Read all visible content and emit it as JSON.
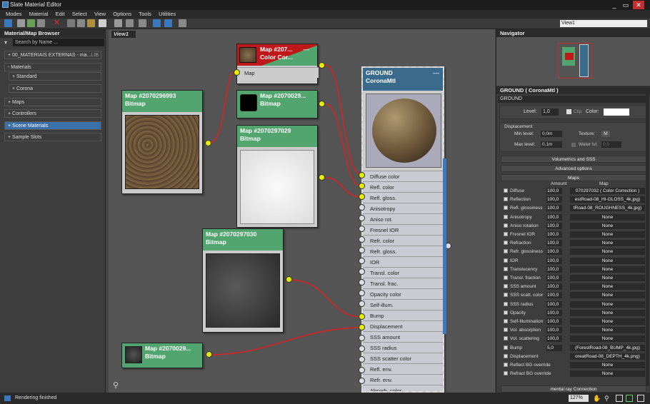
{
  "window": {
    "title": "Slate Material Editor",
    "minimize": "_",
    "restore": "▭",
    "close": "✕"
  },
  "menu": [
    "Modes",
    "Material",
    "Edit",
    "Select",
    "View",
    "Options",
    "Tools",
    "Utilities"
  ],
  "toolbar": {
    "view_select": "View1"
  },
  "browser": {
    "title": "Material/Map Browser",
    "search_placeholder": "Search by Name ...",
    "rows": [
      "+ 00_MATERIAIS EXTERNAS - ma...",
      "- Materials",
      "+ Standard",
      "+ Corona",
      "+ Maps",
      "+ Controllers",
      "+ Scene Materials",
      "+ Sample Slots"
    ],
    "lib_tag": "LIB"
  },
  "view_tab": "View1",
  "nodes": {
    "cc": {
      "title": "Map  #207...",
      "subtitle": "Color Cor...",
      "slot": "Map"
    },
    "n5": {
      "title": "Map  #2070296993",
      "subtitle": "Bitmap"
    },
    "n6": {
      "title": "Map  #2070029...",
      "subtitle": "Bitmap"
    },
    "n7": {
      "title": "Map  #2070297029",
      "subtitle": "Bitmap"
    },
    "n8": {
      "title": "Map  #2070297030",
      "subtitle": "Bitmap"
    },
    "n9": {
      "title": "Map  #2070029...",
      "subtitle": "Bitmap"
    },
    "ground": {
      "title": "GROUND",
      "subtitle": "CoronaMtl",
      "minimize": "—"
    }
  },
  "slots": [
    "Diffuse color",
    "Refl. color",
    "Refl. gloss.",
    "Anisotropy",
    "Aniso rot.",
    "Fresnel IOR",
    "Refr. color",
    "Refr. gloss.",
    "IOR",
    "Transl. color",
    "Transl. frac.",
    "Opacity color",
    "Self-illum.",
    "Bump",
    "Displacement",
    "SSS amount",
    "SSS radius",
    "SSS scatter color",
    "Refl. env.",
    "Refr. env.",
    "Absorb. color"
  ],
  "connected_slots": [
    "Diffuse color",
    "Refl. color",
    "Refl. gloss.",
    "Bump",
    "Displacement"
  ],
  "navigator": {
    "title": "Navigator"
  },
  "params": {
    "header": "GROUND  ( CoronaMtl )",
    "name_field": "GROUND",
    "level_label": "Level:",
    "level_value": "1,0",
    "clip_label": "Clip",
    "color_label": "Color:",
    "displacement_group": "Displacement",
    "min_level_label": "Min level:",
    "min_level_value": "0,0m",
    "max_level_label": "Max level:",
    "max_level_value": "0,1m",
    "texture_label": "Texture:",
    "texture_value": "M",
    "water_label": "Water lvl.",
    "water_value": "0,0",
    "rollouts": [
      "Volumetrics and SSS",
      "Advanced options",
      "Maps",
      "mental ray Connection"
    ],
    "amount_col": "Amount",
    "map_col": "Map",
    "maps": [
      {
        "name": "Diffuse",
        "amount": "100,0",
        "map": "070297032  ( Color Correction )"
      },
      {
        "name": "Reflection",
        "amount": "100,0",
        "map": "estRoad-08_HI-GLOSS_4k.jpg)"
      },
      {
        "name": "Refl. glossiness",
        "amount": "100,0",
        "map": "tRoad-08_ROUGHNESS_4k.jpg)"
      },
      {
        "name": "Anisotropy",
        "amount": "100,0",
        "map": "None"
      },
      {
        "name": "Aniso rotation",
        "amount": "100,0",
        "map": "None"
      },
      {
        "name": "Fresnel IOR",
        "amount": "100,0",
        "map": "None"
      },
      {
        "name": "Refraction",
        "amount": "100,0",
        "map": "None"
      },
      {
        "name": "Refr. glossiness",
        "amount": "100,0",
        "map": "None"
      },
      {
        "name": "IOR",
        "amount": "100,0",
        "map": "None"
      },
      {
        "name": "Translucency",
        "amount": "100,0",
        "map": "None"
      },
      {
        "name": "Transl. fraction",
        "amount": "100,0",
        "map": "None"
      },
      {
        "name": "SSS amount",
        "amount": "100,0",
        "map": "None"
      },
      {
        "name": "SSS scatt. color",
        "amount": "100,0",
        "map": "None"
      },
      {
        "name": "SSS radius",
        "amount": "100,0",
        "map": "None"
      },
      {
        "name": "Opacity",
        "amount": "100,0",
        "map": "None"
      },
      {
        "name": "Self-Illumination",
        "amount": "100,0",
        "map": "None"
      },
      {
        "name": "Vol. absorption",
        "amount": "100,0",
        "map": "None"
      },
      {
        "name": "Vol. scattering",
        "amount": "100,0",
        "map": "None"
      },
      {
        "name": "Bump",
        "amount": "5,0",
        "map": "(ForestRoad-08_BUMP_4k.jpg)"
      },
      {
        "name": "Displacement",
        "amount": "",
        "map": "oreatRoad-08_DEPTH_4k.png)"
      },
      {
        "name": "Reflect BG override",
        "amount": "",
        "map": "None"
      },
      {
        "name": "Refract BG override",
        "amount": "",
        "map": "None"
      }
    ]
  },
  "status": {
    "text": "Rendering finished",
    "zoom": "127%"
  }
}
